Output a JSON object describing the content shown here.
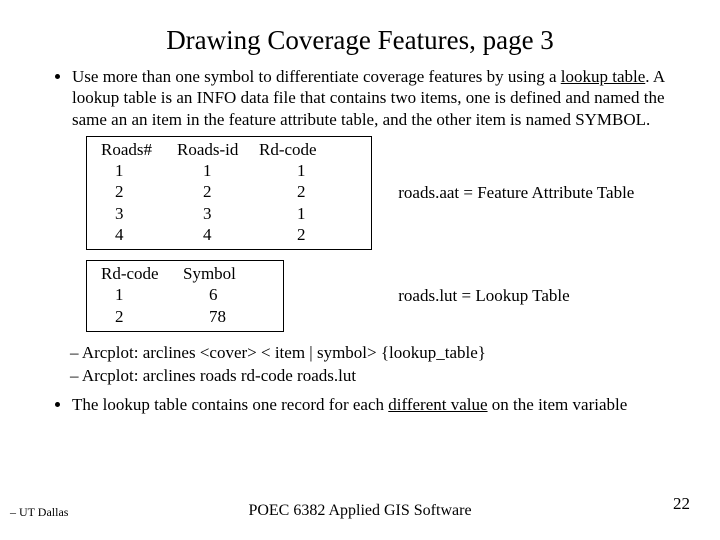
{
  "title": "Drawing Coverage Features, page 3",
  "bullet1_a": "Use more than one symbol to differentiate coverage features by using a ",
  "bullet1_b": "lookup table",
  "bullet1_c": ".  A lookup table is an INFO data file that contains two items, one is defined and named the same an an item in the feature attribute table, and the other item is named SYMBOL.",
  "table1": {
    "h": [
      "Roads#",
      "Roads-id",
      "Rd-code"
    ],
    "rows": [
      [
        "1",
        "1",
        "1"
      ],
      [
        "2",
        "2",
        "2"
      ],
      [
        "3",
        "3",
        "1"
      ],
      [
        "4",
        "4",
        "2"
      ]
    ]
  },
  "caption1": "roads.aat  =   Feature Attribute Table",
  "table2": {
    "h": [
      "Rd-code",
      "Symbol"
    ],
    "rows": [
      [
        "1",
        "6"
      ],
      [
        "2",
        "78"
      ]
    ]
  },
  "caption2": "roads.lut  =   Lookup Table",
  "sub1": "Arcplot: arclines <cover> < item | symbol> {lookup_table}",
  "sub2": "Arcplot: arclines  roads   rd-code   roads.lut",
  "bullet2_a": "The lookup table contains one record for each ",
  "bullet2_b": "different value",
  "bullet2_c": " on the item variable",
  "footer_left": "– UT Dallas",
  "footer_center": "POEC 6382 Applied GIS Software",
  "page_num": "22"
}
